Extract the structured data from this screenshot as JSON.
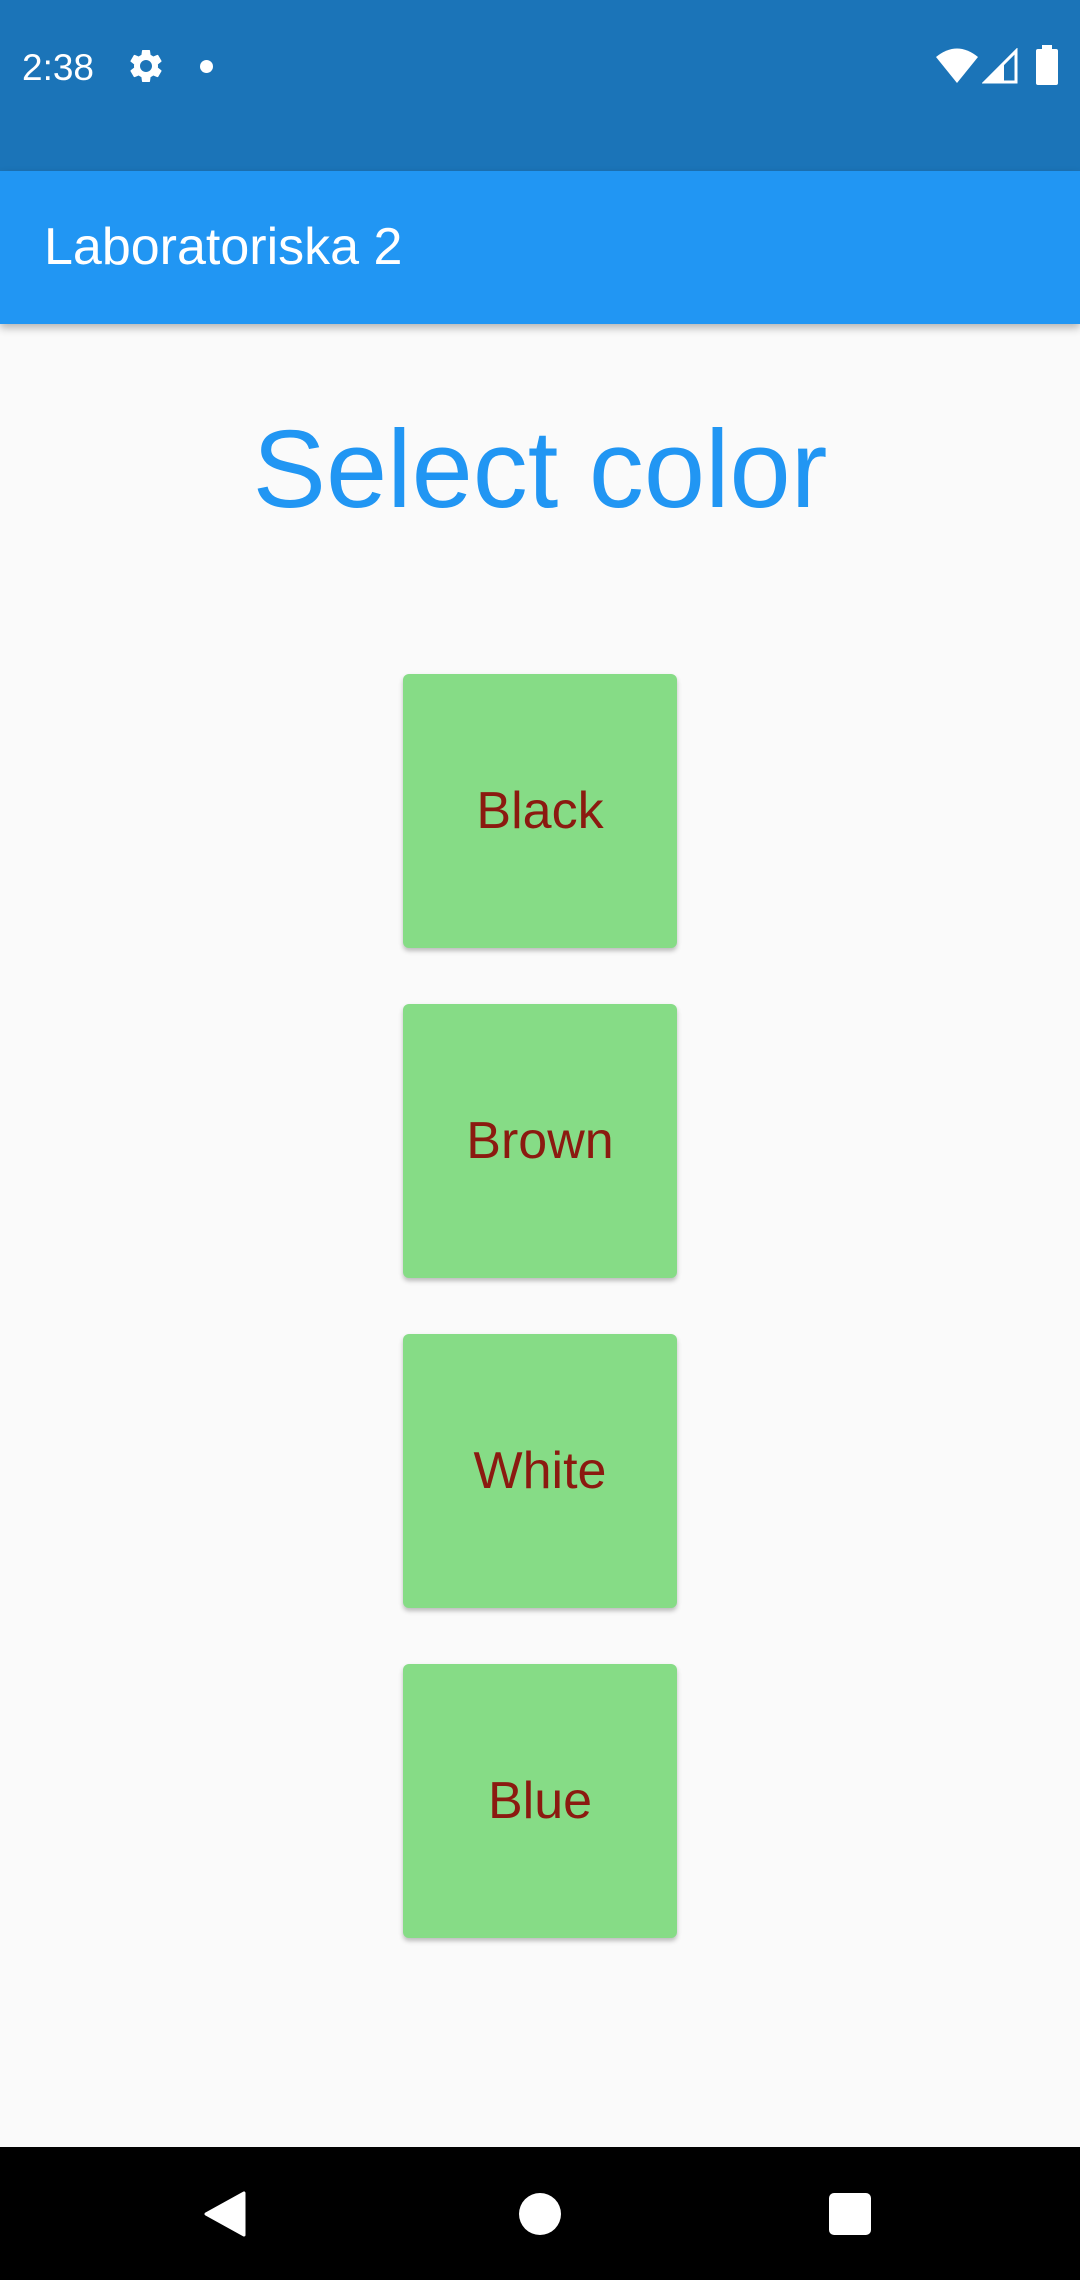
{
  "status_bar": {
    "time": "2:38",
    "icons": [
      "gear-icon",
      "notification-dot-icon",
      "wifi-icon",
      "cell-signal-icon",
      "battery-icon"
    ]
  },
  "app_bar": {
    "title": "Laboratoriska 2"
  },
  "main": {
    "heading": "Select color",
    "buttons": [
      {
        "label": "Black"
      },
      {
        "label": "Brown"
      },
      {
        "label": "White"
      },
      {
        "label": "Blue"
      }
    ]
  },
  "nav_bar": {
    "icons": [
      "back-icon",
      "home-icon",
      "recents-icon"
    ]
  },
  "colors": {
    "status_bar": "#1b74b8",
    "app_bar": "#2196f3",
    "heading": "#2196f3",
    "button_bg": "#86dc86",
    "button_text": "#8b1a10",
    "background": "#fafafa"
  }
}
